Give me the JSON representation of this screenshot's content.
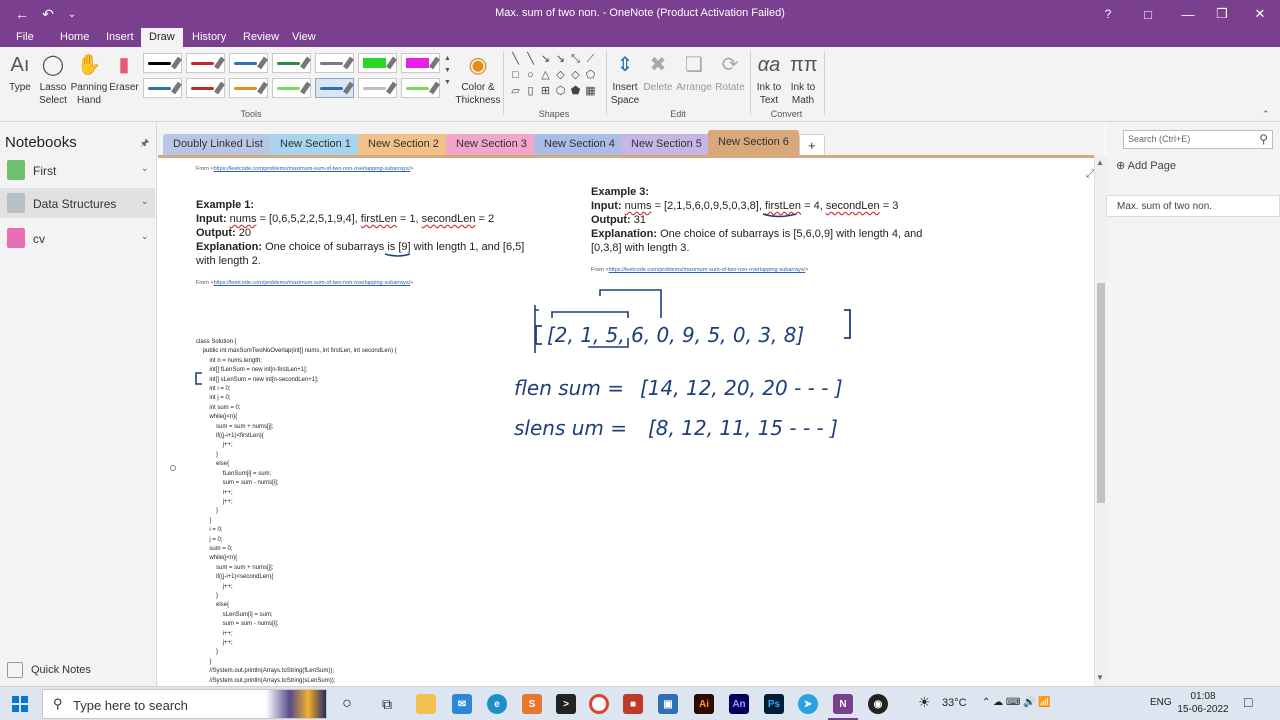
{
  "window": {
    "title": "Max. sum of two non. - OneNote (Product Activation Failed)"
  },
  "menu": {
    "tabs": [
      {
        "label": "File"
      },
      {
        "label": "Home"
      },
      {
        "label": "Insert"
      },
      {
        "label": "Draw"
      },
      {
        "label": "History"
      },
      {
        "label": "Review"
      },
      {
        "label": "View"
      }
    ],
    "active": "Draw"
  },
  "ribbon": {
    "tools": {
      "type": "Type",
      "lasso": "Lasso\nSelect",
      "panning": "Panning\nHand",
      "eraser": "Eraser",
      "color": "Color &\nThickness",
      "group": "Tools"
    },
    "pen_colors": [
      "#000000",
      "#c0272d",
      "#2e6fb5",
      "#2e8b3d",
      "#7a7a7a",
      "#2bd62b",
      "#e61ee6",
      "#2e6fb5",
      "#c0272d",
      "#e98a1f",
      "#7ed957",
      "#2e6fb5",
      "#bdbdbd",
      "#7ed957"
    ],
    "shapes_group": "Shapes",
    "edit": {
      "insert_space": "Insert\nSpace",
      "delete": "Delete",
      "arrange": "Arrange",
      "rotate": "Rotate",
      "group": "Edit"
    },
    "convert": {
      "ink_to_text": "Ink to\nText",
      "ink_to_math": "Ink to\nMath",
      "group": "Convert"
    }
  },
  "notebooks": {
    "title": "Notebooks",
    "items": [
      {
        "label": "First",
        "color": "#6cc070"
      },
      {
        "label": "Data Structures",
        "color": "#b8bfc9"
      },
      {
        "label": "cv",
        "color": "#e86fb5"
      }
    ],
    "quick_notes": "Quick Notes"
  },
  "sections": {
    "tabs": [
      {
        "label": "Doubly Linked List",
        "color": "#b9c7e6"
      },
      {
        "label": "New Section 1",
        "color": "#a9d4ef"
      },
      {
        "label": "New Section 2",
        "color": "#f2c18a"
      },
      {
        "label": "New Section 3",
        "color": "#f2a6cc"
      },
      {
        "label": "New Section 4",
        "color": "#a9bde6"
      },
      {
        "label": "New Section 5",
        "color": "#c6b6e6"
      },
      {
        "label": "New Section 6",
        "color": "#d9a77c"
      }
    ],
    "add": "+"
  },
  "pages": {
    "search_placeholder": "Search (Ctrl+E)",
    "add_page": "Add Page",
    "items": [
      {
        "label": "Max. sum of two non."
      }
    ]
  },
  "note": {
    "from_prefix": "From <",
    "from_url": "https://leetcode.com/problems/maximum-sum-of-two-non-overlapping-subarrays/",
    "from_suffix": ">",
    "example1": {
      "title": "Example 1:",
      "input_label": "Input:",
      "input_pre": "nums",
      "input_mid": " = [0,6,5,2,2,5,1,9,4], ",
      "first_len": "firstLen",
      "input_mid2": " = 1, ",
      "second_len": "secondLen",
      "input_end": " = 2",
      "output_label": "Output:",
      "output": "20",
      "expl_label": "Explanation:",
      "explanation": "One choice of subarrays is [9] with length 1, and [6,5] with length 2."
    },
    "example3": {
      "title": "Example 3:",
      "input_label": "Input:",
      "input_pre": "nums",
      "input_mid": " = [2,1,5,6,0,9,5,0,3,8], ",
      "first_len": "firstLen",
      "input_mid2": " = 4, ",
      "second_len": "secondLen",
      "input_end": " = 3",
      "output_label": "Output:",
      "output": "31",
      "expl_label": "Explanation:",
      "explanation": "One choice of subarrays is [5,6,0,9] with length 4, and [0,3,8] with length 3."
    },
    "code": "class Solution {\n    public int maxSumTwoNoOverlap(int[] nums, int firstLen, int secondLen) {\n        int n = nums.length;\n        int[] fLenSum = new int[n-firstLen+1];\n        int[] sLenSum = new int[n-secondLen+1];\n        int i = 0;\n        int j = 0;\n        int sum = 0;\n        while(j<n){\n            sum = sum + nums[j];\n            if((j-i+1)<firstLen){\n                j++;\n            }\n            else{\n                fLenSum[i] = sum;\n                sum = sum - nums[i];\n                i++;\n                j++;\n            }\n        }\n        i = 0;\n        j = 0;\n        sum = 0;\n        while(j<n){\n            sum = sum + nums[j];\n            if((j-i+1)<secondLen){\n                j++;\n            }\n            else{\n                sLenSum[i] = sum;\n                sum = sum - nums[i];\n                i++;\n                j++;\n            }\n        }\n        //System.out.println(Arrays.toString(fLenSum));\n        //System.out.println(Arrays.toString(sLenSum));",
    "ink": {
      "array": "[2, 1, 5, 6, 0, 9, 5, 0, 3, 8]",
      "flen_label": "flen sum =",
      "flen_values": "[14, 12, 20, 20 - - - ]",
      "slen_label": "slens um =",
      "slen_values": "[8, 12, 11, 15 - - - ]"
    }
  },
  "taskbar": {
    "search": "Type here to search",
    "weather": "33°C",
    "lang": "ENG",
    "time": "01:08",
    "date": "15-06-2022",
    "apps": [
      {
        "label": "Ai",
        "color": "#2d0a00",
        "fg": "#ff9a00"
      },
      {
        "label": "An",
        "color": "#00005b",
        "fg": "#9999ff"
      },
      {
        "label": "Ps",
        "color": "#001e36",
        "fg": "#31a8ff"
      }
    ]
  }
}
